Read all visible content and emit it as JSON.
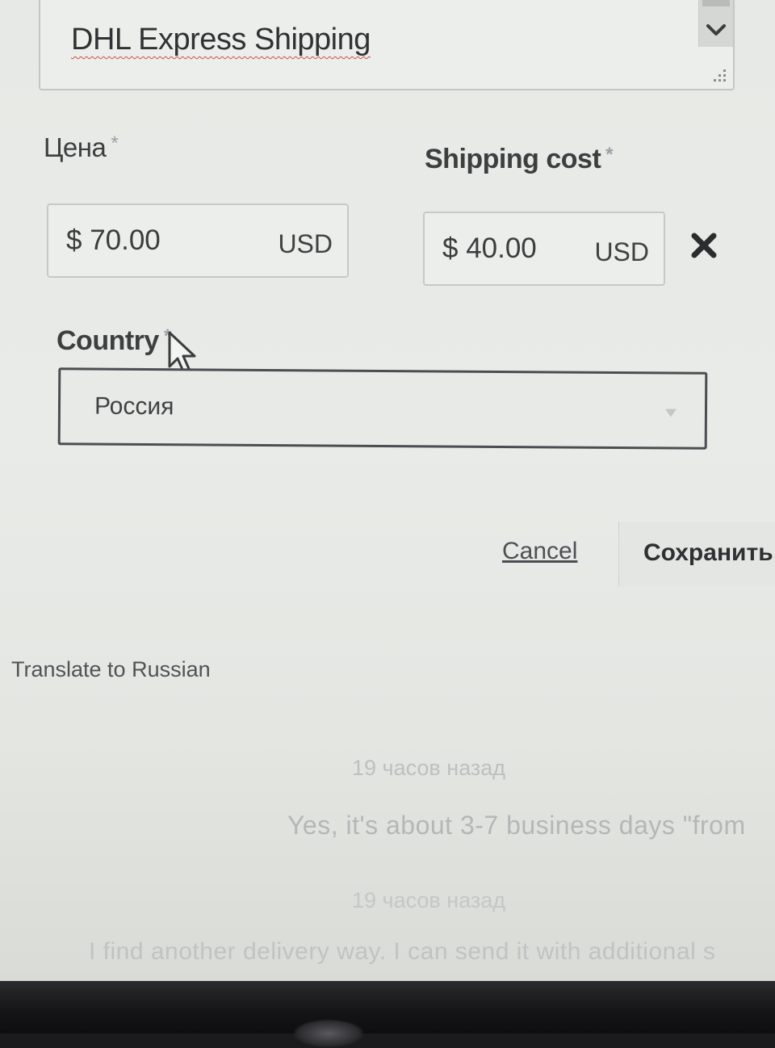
{
  "shipping": {
    "method_value": "DHL Express Shipping",
    "price_label": "Цена",
    "price_required_mark": "*",
    "price_amount": "$ 70.00",
    "price_currency": "USD",
    "shipping_cost_label": "Shipping cost",
    "shipping_cost_required_mark": "*",
    "shipping_cost_amount": "$ 40.00",
    "shipping_cost_currency": "USD",
    "country_label": "Country",
    "country_required_mark": "*",
    "country_value": "Россия"
  },
  "actions": {
    "cancel_label": "Cancel",
    "save_label": "Сохранить"
  },
  "translate_label": "Translate to Russian",
  "messages": [
    {
      "time": "19 часов назад",
      "text": "Yes, it's about 3-7 business days \"from"
    },
    {
      "time": "19 часов назад",
      "text": "I find another delivery way. I can send it with additional s"
    }
  ],
  "icons": {
    "chevron": "chevron-down-icon",
    "close": "close-icon",
    "cursor": "cursor-icon",
    "grip": "resize-grip-icon"
  }
}
